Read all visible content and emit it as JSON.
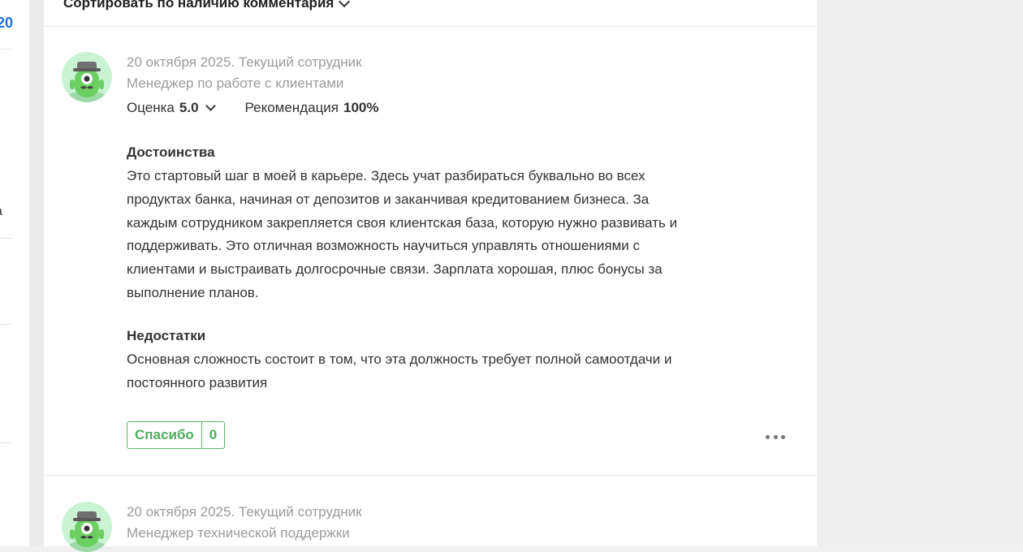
{
  "left_column": {
    "fragment_top": "20",
    "fragment_mid1": "·",
    "fragment_mid2": "а"
  },
  "sort": {
    "label": "Сортировать по наличию комментария"
  },
  "reviews": [
    {
      "avatar": "reviewer-avatar-icon",
      "date_status": "20 октября 2025. Текущий сотрудник",
      "position": "Менеджер по работе с клиентами",
      "rating_label": "Оценка",
      "rating_value": "5.0",
      "recommend_label": "Рекомендация",
      "recommend_value": "100%",
      "pros_title": "Достоинства",
      "pros_lines": [
        "Это стартовый шаг в моей в карьере. Здесь учат разбираться буквально во всех",
        "продуктах банка, начиная от депозитов и заканчивая кредитованием бизнеса. За",
        "каждым сотрудником закрепляется своя клиентская база, которую нужно развивать и",
        "поддерживать. Это отличная возможность научиться управлять отношениями с",
        "клиентами и выстраивать долгосрочные связи. Зарплата хорошая, плюс бонусы за",
        "выполнение планов."
      ],
      "cons_title": "Недостатки",
      "cons_lines": [
        "Основная сложность состоит в том, что эта должность требует полной самоотдачи и",
        "постоянного развития"
      ],
      "thanks_label": "Спасибо",
      "thanks_count": "0",
      "more_icon": "more-dots-icon"
    },
    {
      "avatar": "reviewer-avatar-icon",
      "date_status": "20 октября 2025. Текущий сотрудник",
      "position": "Менеджер технической поддержки"
    }
  ],
  "colors": {
    "accent_green": "#4caf5a",
    "link_blue": "#1a73d9",
    "meta_gray": "#9b9b9b",
    "avatar_bg": "#c9f3d3"
  }
}
